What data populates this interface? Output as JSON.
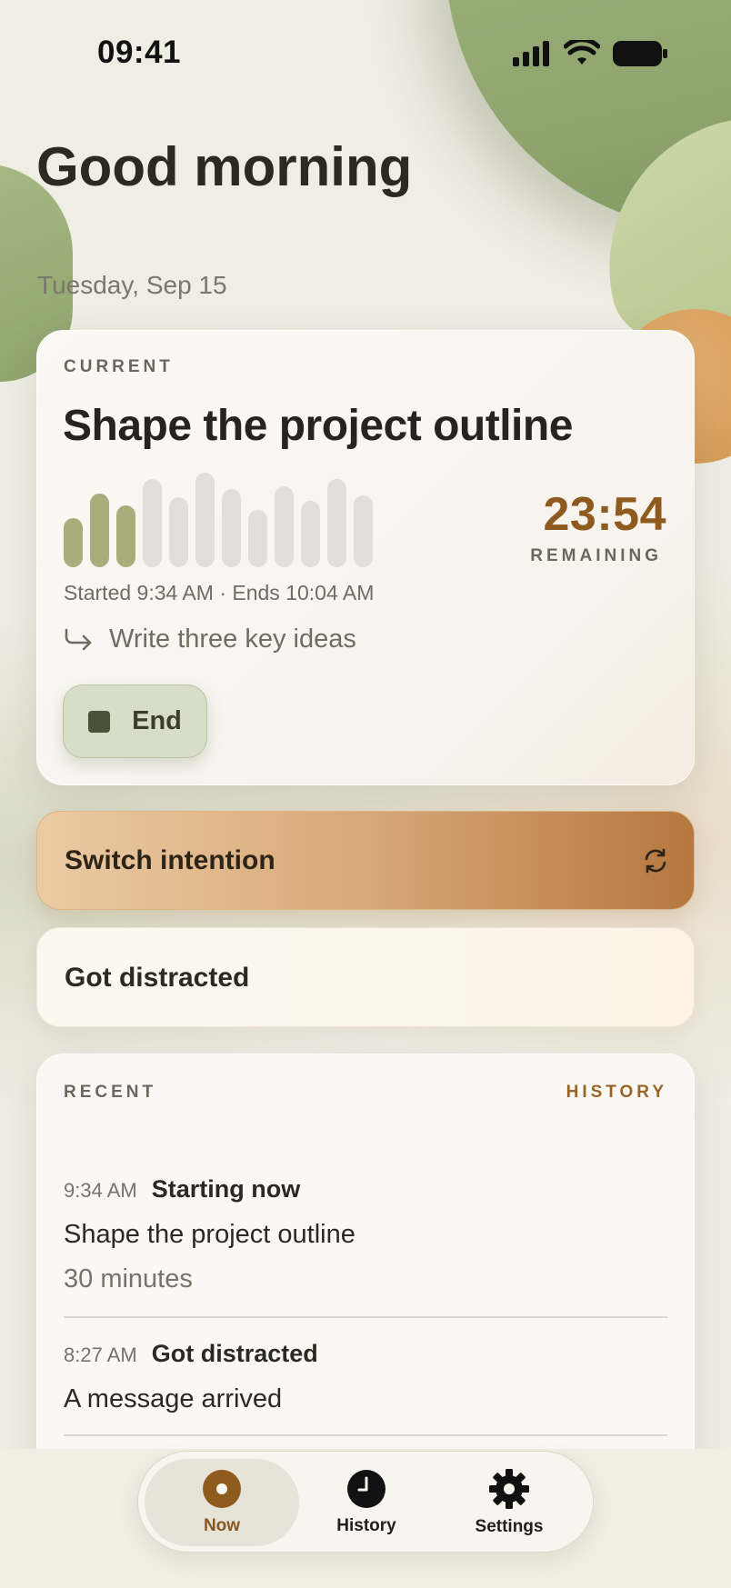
{
  "status_bar": {
    "time": "09:41"
  },
  "header": {
    "greeting": "Good morning",
    "date": "Tuesday, Sep 15"
  },
  "current": {
    "eyebrow": "CURRENT",
    "title": "Shape the project outline",
    "progress_bars": [
      {
        "level": 0.52,
        "active": true
      },
      {
        "level": 0.78,
        "active": true
      },
      {
        "level": 0.65,
        "active": true
      },
      {
        "level": 0.93,
        "active": false
      },
      {
        "level": 0.74,
        "active": false
      },
      {
        "level": 1.0,
        "active": false
      },
      {
        "level": 0.83,
        "active": false
      },
      {
        "level": 0.61,
        "active": false
      },
      {
        "level": 0.86,
        "active": false
      },
      {
        "level": 0.7,
        "active": false
      },
      {
        "level": 0.93,
        "active": false
      },
      {
        "level": 0.76,
        "active": false
      }
    ],
    "timer": "23:54",
    "timer_label": "REMAINING",
    "times": "Started 9:34 AM · Ends 10:04 AM",
    "next_step": "Write three key ideas",
    "end_label": "End"
  },
  "actions": {
    "switch_label": "Switch intention",
    "distracted_label": "Got distracted"
  },
  "recent": {
    "eyebrow": "RECENT",
    "history_link": "HISTORY",
    "entries": [
      {
        "time": "9:34 AM",
        "title": "Starting now",
        "detail": "Shape the project outline",
        "sub": "30 minutes"
      },
      {
        "time": "8:27 AM",
        "title": "Got distracted",
        "detail": "A message arrived"
      }
    ]
  },
  "tabbar": {
    "tabs": [
      {
        "label": "Now",
        "icon": "record-icon"
      },
      {
        "label": "History",
        "icon": "clock-icon"
      },
      {
        "label": "Settings",
        "icon": "gear-icon"
      }
    ]
  },
  "colors": {
    "accent": "#8e5a1e",
    "sage": "#a9ad7c",
    "background": "#efede4"
  }
}
